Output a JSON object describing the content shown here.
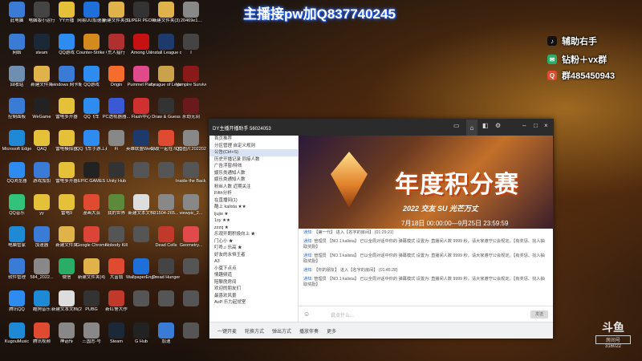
{
  "overlay": {
    "headline": "主播接pw加Q837740245",
    "side": [
      {
        "icon": "tiktok-icon",
        "text": "辅助右手"
      },
      {
        "icon": "wechat-icon",
        "text": "钻粉＋vx群"
      },
      {
        "icon": "qq-icon",
        "text": "群485450943"
      }
    ]
  },
  "desktop_icons": [
    {
      "label": "此电脑",
      "color": "#3a7bd5"
    },
    {
      "label": "电脑版小运行",
      "color": "#444"
    },
    {
      "label": "YY开播",
      "color": "#e5c13a"
    },
    {
      "label": "网易UU加速器",
      "color": "#1e6fd9"
    },
    {
      "label": "新建文件夹(2)",
      "color": "#e0b24a"
    },
    {
      "label": "SUPER PEOPLE CBT",
      "color": "#333"
    },
    {
      "label": "新建文件夹(3)",
      "color": "#e0b24a"
    },
    {
      "label": "20469e1...",
      "color": "#888"
    },
    {
      "label": "网络",
      "color": "#3a7bd5"
    },
    {
      "label": "steam",
      "color": "#1b2838"
    },
    {
      "label": "QQ游戏",
      "color": "#2e8bef"
    },
    {
      "label": "Counter-Strike Global Off...",
      "color": "#d48b1e"
    },
    {
      "label": "荒人猎行",
      "color": "#b03030"
    },
    {
      "label": "Among Us",
      "color": "#c51111"
    },
    {
      "label": "Install League of...",
      "color": "#1d3a6a"
    },
    {
      "label": "I",
      "color": "#444"
    },
    {
      "label": "回收站",
      "color": "#6f8fb0"
    },
    {
      "label": "新建文件夹",
      "color": "#e0b24a"
    },
    {
      "label": "windows 网卡配置",
      "color": "#3a7bd5"
    },
    {
      "label": "QQ游戏",
      "color": "#2e8bef"
    },
    {
      "label": "Origin",
      "color": "#f56c2d"
    },
    {
      "label": "Pummel Party",
      "color": "#e04a8a"
    },
    {
      "label": "League of Legends",
      "color": "#c9a24a"
    },
    {
      "label": "Vampire Survivors",
      "color": "#8a1a1a"
    },
    {
      "label": "控制面板",
      "color": "#3a7bd5"
    },
    {
      "label": "WeGame",
      "color": "#222"
    },
    {
      "label": "雷电多开器",
      "color": "#e5c13a"
    },
    {
      "label": "QQ飞车",
      "color": "#2e8bef"
    },
    {
      "label": "PC透视器器...",
      "color": "#3a5ad5"
    },
    {
      "label": "Flash中心",
      "color": "#d03030"
    },
    {
      "label": "Draw & Guess",
      "color": "#333"
    },
    {
      "label": "永劫无间",
      "color": "#6a1a1a"
    },
    {
      "label": "Microsoft Edge",
      "color": "#1e8ad6"
    },
    {
      "label": "QAQ",
      "color": "#e5c13a"
    },
    {
      "label": "雷电模拟器",
      "color": "#e5c13a"
    },
    {
      "label": "QQ飞车手游工具",
      "color": "#2e8bef"
    },
    {
      "label": "Fi",
      "color": "#888"
    },
    {
      "label": "英雄联盟WeGame版",
      "color": "#1d3a6a"
    },
    {
      "label": "好友一起在斗鱼",
      "color": "#e04a30"
    },
    {
      "label": "QQ图片2022022...",
      "color": "#888"
    },
    {
      "label": "QQ浏览器",
      "color": "#2e8bef"
    },
    {
      "label": "游戏加加",
      "color": "#3a7bd5"
    },
    {
      "label": "雷电多开器",
      "color": "#e5c13a"
    },
    {
      "label": "EPIC GAMES",
      "color": "#222"
    },
    {
      "label": "Unity Hub",
      "color": "#333"
    },
    {
      "label": "",
      "color": "#555"
    },
    {
      "label": "",
      "color": "#555"
    },
    {
      "label": "Inside the Backroo...",
      "color": "#555"
    },
    {
      "label": "QQ音乐",
      "color": "#31c27c"
    },
    {
      "label": "yy",
      "color": "#e5c13a"
    },
    {
      "label": "雷电9",
      "color": "#e5c13a"
    },
    {
      "label": "漫画大派",
      "color": "#e04a30"
    },
    {
      "label": "我的世界",
      "color": "#5a8a3a"
    },
    {
      "label": "新建文本文档",
      "color": "#ddd"
    },
    {
      "label": "31504-265...",
      "color": "#888"
    },
    {
      "label": "viewpic_2...",
      "color": "#888"
    },
    {
      "label": "电脑管家",
      "color": "#1e8ad6"
    },
    {
      "label": "加速器",
      "color": "#3a7bd5"
    },
    {
      "label": "新建文件夹",
      "color": "#e0b24a"
    },
    {
      "label": "Google Chrome",
      "color": "#db4437"
    },
    {
      "label": "Nobody Kill",
      "color": "#555"
    },
    {
      "label": "",
      "color": "#555"
    },
    {
      "label": "Dead Cells",
      "color": "#c0392b"
    },
    {
      "label": "Geometry...",
      "color": "#e04a4a"
    },
    {
      "label": "软件管理",
      "color": "#3a7bd5"
    },
    {
      "label": "584_2022...",
      "color": "#888"
    },
    {
      "label": "微信",
      "color": "#2aae67"
    },
    {
      "label": "新建文件夹(4)",
      "color": "#e0b24a"
    },
    {
      "label": "大富翁",
      "color": "#e04a30"
    },
    {
      "label": "WallpaperEngine",
      "color": "#1e6fd9"
    },
    {
      "label": "Dread Hunger",
      "color": "#444"
    },
    {
      "label": "",
      "color": "#555"
    },
    {
      "label": "腾讯QQ",
      "color": "#2e8bef"
    },
    {
      "label": "酷狗音乐",
      "color": "#1e8ad6"
    },
    {
      "label": "新建文本文档(2)",
      "color": "#ddd"
    },
    {
      "label": "PUBG",
      "color": "#333"
    },
    {
      "label": "新红警大作",
      "color": "#c0392b"
    },
    {
      "label": "",
      "color": "#555"
    },
    {
      "label": "",
      "color": "#555"
    },
    {
      "label": "",
      "color": "#555"
    },
    {
      "label": "KugouMusic",
      "color": "#1e8ad6"
    },
    {
      "label": "腾讯视频",
      "color": "#e04a30"
    },
    {
      "label": "神话传",
      "color": "#888"
    },
    {
      "label": "三国志-号",
      "color": "#888"
    },
    {
      "label": "Steam",
      "color": "#1b2838"
    },
    {
      "label": "G Hub",
      "color": "#222"
    },
    {
      "label": "加速",
      "color": "#3a7bd5"
    },
    {
      "label": "",
      "color": "#555"
    }
  ],
  "window": {
    "title": "DY主播开播助手   56024053",
    "left_items": [
      "首页推荐",
      "分区管理  自定义规则",
      "公告(Ctrl+S)",
      "历史开播记录  同接人数",
      "广告浮窗/特效",
      "娱乐类通知人数",
      "娱乐类通知人数",
      "粉丝人数  近期关注",
      "Fifth分析",
      "在直播间(1)",
      "酷上 kalista  ★★",
      "ljujie  ★",
      "1sy  ★★",
      "zzzq  ★",
      "乐观开朗积极向上  ★",
      "门心小  ★",
      "叮咚♫ 乐高  ★",
      "好友的永恒王者",
      "A3",
      "小莫下点点",
      "情趣频道",
      "陪聊房房间",
      "欢迎的朋友们",
      "最喜欢风景",
      "AoP 乐力起觉室"
    ],
    "banner": {
      "title": "年度积分赛",
      "subtitle": "2022 交友 SU 光芒万丈",
      "dates": "7月18日  00:00:00—9月25日  23:59:59"
    },
    "chat": [
      {
        "user": "通知:",
        "text": "【第一代】 进入【名字的房间】  (01:29:21)"
      },
      {
        "user": "通知:",
        "text": "管理员 【NO.1 kalista】 已以全局对话中你的 弹幕模式 设置为: 直播间人数 9999 秒，请大家遵守公会规定。【有奖惩、找人抽取奖励】"
      },
      {
        "user": "通知:",
        "text": "管理员 【NO.1 kalista】 已以全局对话中你的 弹幕模式 设置为: 直播间人数 9999 秒，请大家遵守公会规定。【有奖惩、找人抽取奖励】"
      },
      {
        "user": "通知:",
        "text": "【你的朋友】 进入【名字的房间】  (01:45:28)"
      },
      {
        "user": "通知:",
        "text": "管理员 【NO.1 kalista】 已以全局对话中你的 弹幕模式 设置为: 直播间人数 9999 秒，请大家遵守公会规定。【有奖惩、找人抽取奖励】"
      }
    ],
    "input_placeholder": "说点什么...",
    "send_label": "发送",
    "bottom": [
      "一键开麦",
      "轮换方式",
      "弹出方式",
      "播放伴奏",
      "更多"
    ]
  },
  "watermark": {
    "brand": "斗鱼",
    "line2": "房间号",
    "line3": "316022"
  }
}
